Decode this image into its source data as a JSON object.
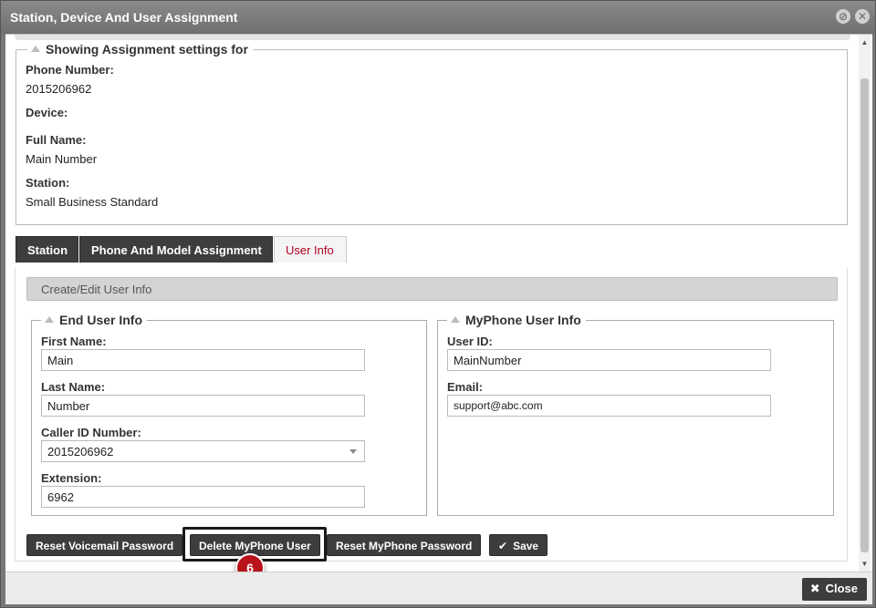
{
  "window": {
    "title": "Station, Device And User Assignment",
    "title_icons": [
      "minimize-icon",
      "close-icon"
    ]
  },
  "assignment": {
    "legend": "Showing Assignment settings for",
    "phone_number_label": "Phone Number:",
    "phone_number": "2015206962",
    "device_label": "Device:",
    "device": "",
    "full_name_label": "Full Name:",
    "full_name": "Main Number",
    "station_label": "Station:",
    "station": "Small Business Standard"
  },
  "tabs": [
    {
      "label": "Station",
      "active": false
    },
    {
      "label": "Phone And Model Assignment",
      "active": false
    },
    {
      "label": "User Info",
      "active": true
    }
  ],
  "user_info": {
    "header": "Create/Edit User Info",
    "end_user": {
      "legend": "End User Info",
      "first_name_label": "First Name:",
      "first_name": "Main",
      "last_name_label": "Last Name:",
      "last_name": "Number",
      "caller_id_label": "Caller ID Number:",
      "caller_id": "2015206962",
      "extension_label": "Extension:",
      "extension": "6962"
    },
    "myphone": {
      "legend": "MyPhone User Info",
      "user_id_label": "User ID:",
      "user_id": "MainNumber",
      "email_label": "Email:",
      "email": "support@abc.com"
    }
  },
  "buttons": {
    "reset_voicemail": "Reset Voicemail Password",
    "delete_myphone": "Delete MyPhone User",
    "reset_myphone": "Reset MyPhone Password",
    "save": "Save"
  },
  "step_marker": "6",
  "footer": {
    "close": "Close"
  },
  "colors": {
    "active_tab_text": "#b00020",
    "marker": "#b8131b",
    "dark_button": "#3d3d3d"
  }
}
